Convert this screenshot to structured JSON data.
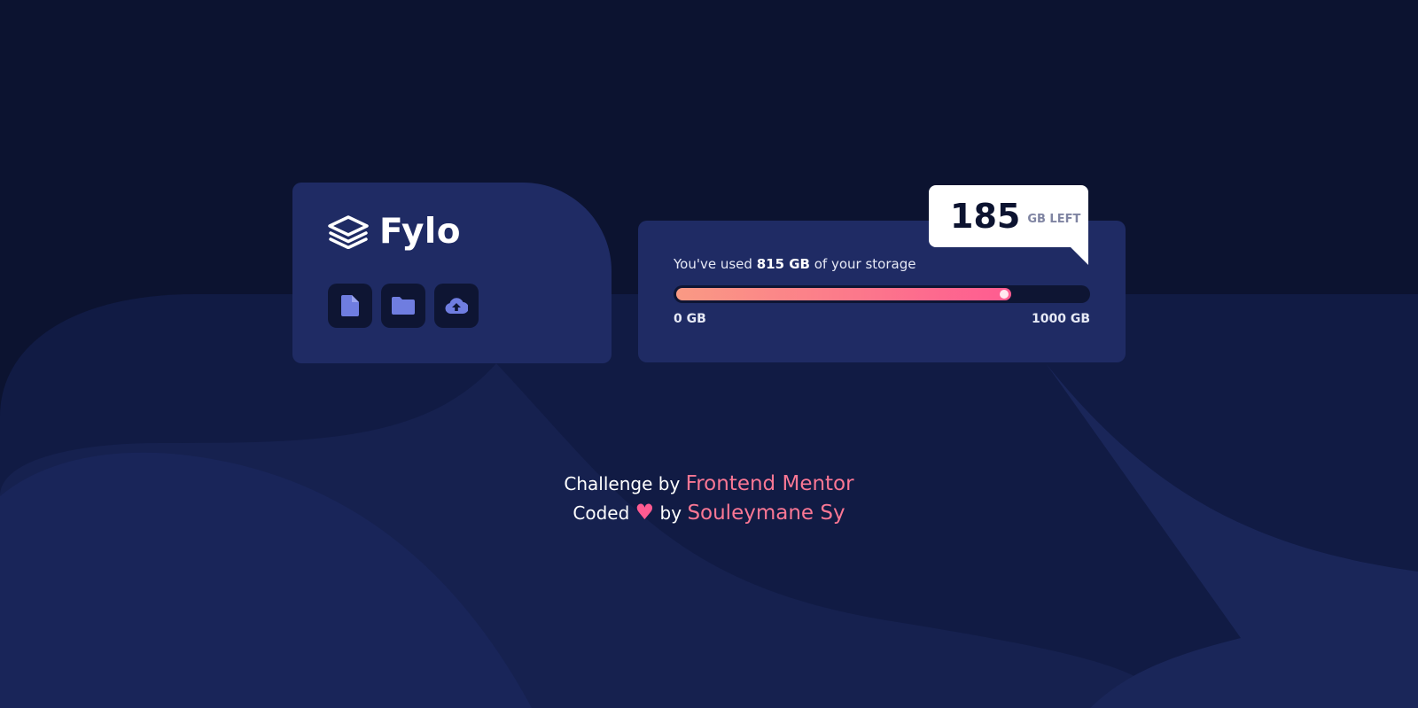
{
  "colors": {
    "background": "#0c1330",
    "card": "#1f2b64",
    "dark": "#0e1533",
    "gradient_start": "#fa9a84",
    "gradient_end": "#fe5b91",
    "link": "#fa7794",
    "button_icon": "#6f7de0"
  },
  "brand": {
    "name": "Fylo",
    "logo_icon": "layers-icon"
  },
  "toolbar": {
    "buttons": [
      {
        "icon": "file-icon"
      },
      {
        "icon": "folder-icon"
      },
      {
        "icon": "cloud-upload-icon"
      }
    ]
  },
  "storage": {
    "used_prefix": "You've used ",
    "used_amount": "815 GB",
    "used_suffix": " of your storage",
    "used_fraction": 0.815,
    "min_label": "0 GB",
    "max_label": "1000 GB",
    "remaining_value": "185",
    "remaining_unit": "GB LEFT"
  },
  "attribution": {
    "challenge_prefix": "Challenge by ",
    "challenge_link": "Frontend Mentor",
    "coded_prefix": "Coded ",
    "heart": "♥",
    "coded_by": " by ",
    "author_link": "Souleymane Sy"
  }
}
